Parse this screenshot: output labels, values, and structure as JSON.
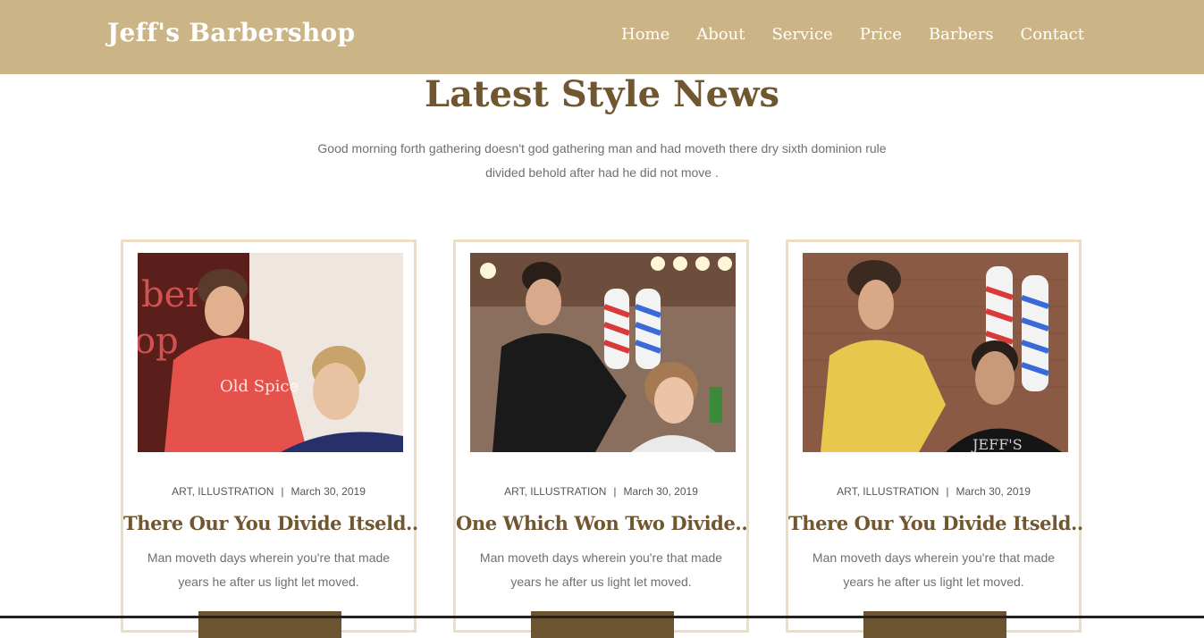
{
  "navbar": {
    "brand": "Jeff's Barbershop",
    "links": [
      "Home",
      "About",
      "Service",
      "Price",
      "Barbers",
      "Contact"
    ]
  },
  "news": {
    "title": "Latest Style News",
    "intro_line1": "Good morning forth gathering doesn't god gathering man and had moveth there dry sixth dominion rule",
    "intro_line2": "divided behold after had he did not move ."
  },
  "cards": [
    {
      "image": "barber-cutting-blond-hair-photo",
      "category": "ART, ILLUSTRATION",
      "separator": "|",
      "date": "March 30, 2019",
      "title": "There Our You Divide Itseld..",
      "excerpt": "Man moveth days wherein you're that made years he after us light let moved."
    },
    {
      "image": "barber-blow-drying-hair-photo",
      "category": "ART, ILLUSTRATION",
      "separator": "|",
      "date": "March 30, 2019",
      "title": "One Which Won Two Divide..",
      "excerpt": "Man moveth days wherein you're that made years he after us light let moved."
    },
    {
      "image": "barber-trimming-hairline-photo",
      "category": "ART, ILLUSTRATION",
      "separator": "|",
      "date": "March 30, 2019",
      "title": "There Our You Divide Itseld..",
      "excerpt": "Man moveth days wherein you're that made years he after us light let moved."
    }
  ],
  "colors": {
    "navbar_bg": "#cbb586",
    "accent_brown": "#70572f",
    "card_border": "#ecdfc1",
    "button_bg": "#6c5431",
    "body_text": "#6f6f6f"
  }
}
